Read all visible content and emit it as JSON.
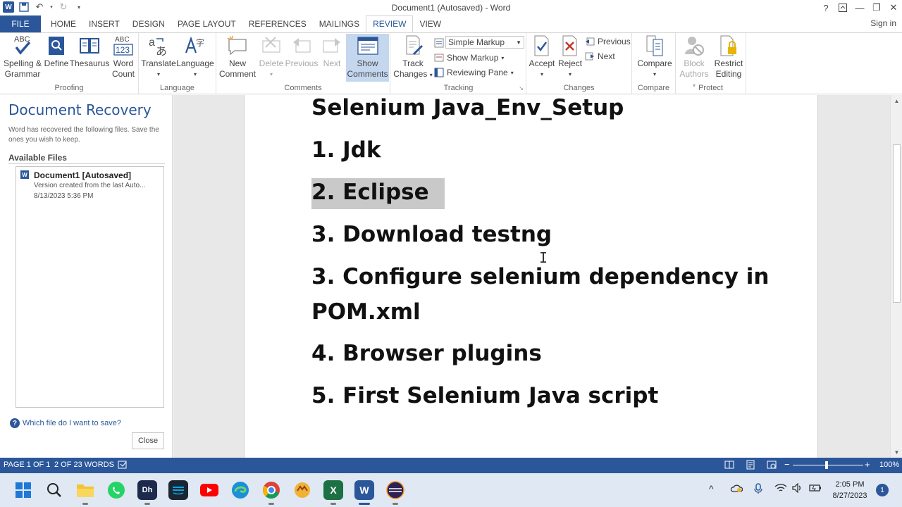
{
  "window": {
    "title": "Document1 (Autosaved) - Word",
    "help_icon": "?",
    "signin": "Sign in"
  },
  "tabs": [
    {
      "label": "FILE"
    },
    {
      "label": "HOME"
    },
    {
      "label": "INSERT"
    },
    {
      "label": "DESIGN"
    },
    {
      "label": "PAGE LAYOUT"
    },
    {
      "label": "REFERENCES"
    },
    {
      "label": "MAILINGS"
    },
    {
      "label": "REVIEW"
    },
    {
      "label": "VIEW"
    }
  ],
  "ribbon": {
    "proofing": {
      "label": "Proofing",
      "spelling": "Spelling &",
      "spelling2": "Grammar",
      "define": "Define",
      "thesaurus": "Thesaurus",
      "wordcount": "Word",
      "wordcount2": "Count",
      "abc": "ABC",
      "abc123a": "ABC",
      "abc123b": "123"
    },
    "language": {
      "label": "Language",
      "translate": "Translate",
      "language": "Language"
    },
    "comments": {
      "label": "Comments",
      "new": "New",
      "new2": "Comment",
      "delete": "Delete",
      "previous": "Previous",
      "next": "Next",
      "show": "Show",
      "show2": "Comments"
    },
    "tracking": {
      "label": "Tracking",
      "track": "Track",
      "track2": "Changes",
      "markup_select": "Simple Markup",
      "show_markup": "Show Markup",
      "reviewing_pane": "Reviewing Pane"
    },
    "changes": {
      "label": "Changes",
      "accept": "Accept",
      "reject": "Reject",
      "previous": "Previous",
      "next": "Next"
    },
    "compare": {
      "label": "Compare",
      "compare": "Compare"
    },
    "protect": {
      "label": "Protect",
      "block": "Block",
      "block2": "Authors",
      "restrict": "Restrict",
      "restrict2": "Editing"
    }
  },
  "recovery": {
    "title": "Document Recovery",
    "description": "Word has recovered the following files.  Save the ones you wish to keep.",
    "available": "Available Files",
    "file_name": "Document1  [Autosaved]",
    "file_sub": "Version created from the last Auto...",
    "file_date": "8/13/2023 5:36 PM",
    "help_link": "Which file do I want to save?",
    "close": "Close"
  },
  "document": {
    "lines": [
      "Selenium Java_Env_Setup",
      "1. Jdk",
      "2. Eclipse",
      "3. Download testng",
      "3. Configure selenium dependency in",
      "POM.xml",
      "4. Browser plugins",
      "5. First Selenium Java script"
    ]
  },
  "statusbar": {
    "page": "PAGE 1 OF 1",
    "words": "2 OF 23 WORDS",
    "zoom": "100%",
    "zoom_minus": "−",
    "zoom_plus": "+"
  },
  "taskbar": {
    "time": "2:05 PM",
    "date": "8/27/2023",
    "notifications": "1",
    "excel_label": "X",
    "word_label": "W",
    "dh_label": "Dh"
  },
  "colors": {
    "accent": "#2b579a",
    "selection": "#c9c9c9"
  }
}
